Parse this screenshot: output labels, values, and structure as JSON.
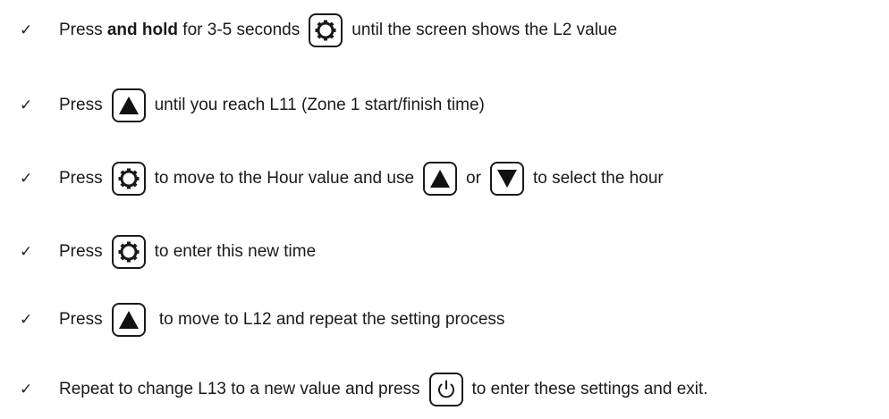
{
  "checkmark": "✓",
  "steps": [
    {
      "parts": [
        {
          "type": "text",
          "value": "Press "
        },
        {
          "type": "bold",
          "value": "and hold"
        },
        {
          "type": "text",
          "value": " for 3-5 seconds"
        },
        {
          "type": "icon",
          "icon": "gear-icon"
        },
        {
          "type": "text",
          "value": "until the screen shows the L2 value"
        }
      ]
    },
    {
      "parts": [
        {
          "type": "text",
          "value": "Press"
        },
        {
          "type": "icon",
          "icon": "up-arrow-icon"
        },
        {
          "type": "text",
          "value": "until you reach L11 (Zone 1 start/finish time)"
        }
      ]
    },
    {
      "parts": [
        {
          "type": "text",
          "value": "Press"
        },
        {
          "type": "icon",
          "icon": "gear-icon"
        },
        {
          "type": "text",
          "value": "to move to the Hour value and use"
        },
        {
          "type": "icon",
          "icon": "up-arrow-icon"
        },
        {
          "type": "text",
          "value": "or"
        },
        {
          "type": "icon",
          "icon": "down-arrow-icon"
        },
        {
          "type": "text",
          "value": "to select the hour"
        }
      ]
    },
    {
      "parts": [
        {
          "type": "text",
          "value": "Press"
        },
        {
          "type": "icon",
          "icon": "gear-icon"
        },
        {
          "type": "text",
          "value": "to enter this new time"
        }
      ]
    },
    {
      "parts": [
        {
          "type": "text",
          "value": "Press"
        },
        {
          "type": "icon",
          "icon": "up-arrow-icon"
        },
        {
          "type": "text",
          "value": " to move to L12 and repeat the setting process"
        }
      ]
    },
    {
      "parts": [
        {
          "type": "text",
          "value": "Repeat to change L13 to a new value and press"
        },
        {
          "type": "icon",
          "icon": "power-icon"
        },
        {
          "type": "text",
          "value": "to enter these settings and exit."
        }
      ]
    }
  ]
}
